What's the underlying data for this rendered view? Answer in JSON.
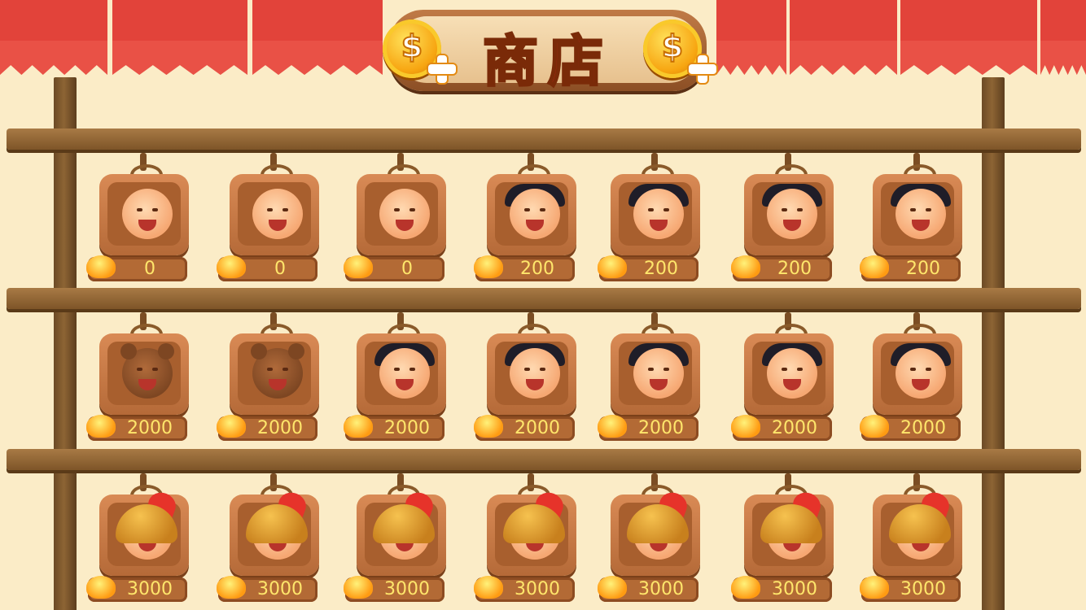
{
  "title": "商店",
  "coin_symbol": "$",
  "shelves": [
    {
      "items": [
        {
          "character": "bald-kid",
          "price": "0"
        },
        {
          "character": "bald-kid",
          "price": "0"
        },
        {
          "character": "bald-kid",
          "price": "0"
        },
        {
          "character": "pigtail-girl",
          "price": "200"
        },
        {
          "character": "pigtail-girl",
          "price": "200"
        },
        {
          "character": "pigtail-girl",
          "price": "200"
        },
        {
          "character": "pigtail-girl",
          "price": "200"
        }
      ]
    },
    {
      "items": [
        {
          "character": "bear",
          "price": "2000"
        },
        {
          "character": "bear",
          "price": "2000"
        },
        {
          "character": "black-hair-boy",
          "price": "2000"
        },
        {
          "character": "black-hair-boy",
          "price": "2000"
        },
        {
          "character": "black-hair-boy",
          "price": "2000"
        },
        {
          "character": "black-hair-boy",
          "price": "2000"
        },
        {
          "character": "black-hair-boy",
          "price": "2000"
        }
      ]
    },
    {
      "items": [
        {
          "character": "spartan-helmet",
          "price": "3000"
        },
        {
          "character": "spartan-helmet",
          "price": "3000"
        },
        {
          "character": "spartan-helmet",
          "price": "3000"
        },
        {
          "character": "spartan-helmet",
          "price": "3000"
        },
        {
          "character": "spartan-helmet",
          "price": "3000"
        },
        {
          "character": "spartan-helmet",
          "price": "3000"
        },
        {
          "character": "spartan-helmet",
          "price": "3000"
        }
      ]
    }
  ],
  "colors": {
    "awning": "#e2433a",
    "wall": "#fbecc7",
    "price_text": "#ffe66b",
    "title": "#e0201e"
  }
}
